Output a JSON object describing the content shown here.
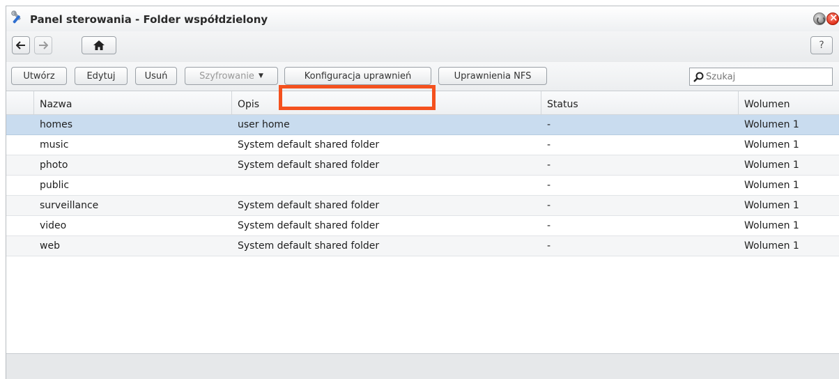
{
  "window": {
    "title": "Panel sterowania - Folder współdzielony",
    "icon": "control-panel-tools-icon"
  },
  "nav": {
    "back_icon": "arrow-left-icon",
    "forward_icon": "arrow-right-icon",
    "home_icon": "home-icon",
    "help_label": "?"
  },
  "toolbar": {
    "create_label": "Utwórz",
    "edit_label": "Edytuj",
    "delete_label": "Usuń",
    "encryption_label": "Szyfrowanie",
    "permissions_label": "Konfiguracja uprawnień",
    "nfs_label": "Uprawnienia NFS",
    "search_placeholder": "Szukaj"
  },
  "table": {
    "columns": [
      "",
      "Nazwa",
      "Opis",
      "Status",
      "Wolumen"
    ],
    "rows": [
      {
        "name": "homes",
        "description": "user home",
        "status": "-",
        "volume": "Wolumen 1",
        "selected": true
      },
      {
        "name": "music",
        "description": "System default shared folder",
        "status": "-",
        "volume": "Wolumen 1"
      },
      {
        "name": "photo",
        "description": "System default shared folder",
        "status": "-",
        "volume": "Wolumen 1"
      },
      {
        "name": "public",
        "description": "",
        "status": "-",
        "volume": "Wolumen 1"
      },
      {
        "name": "surveillance",
        "description": "System default shared folder",
        "status": "-",
        "volume": "Wolumen 1"
      },
      {
        "name": "video",
        "description": "System default shared folder",
        "status": "-",
        "volume": "Wolumen 1"
      },
      {
        "name": "web",
        "description": "System default shared folder",
        "status": "-",
        "volume": "Wolumen 1"
      }
    ]
  },
  "colors": {
    "selected_row": "#c9dcef",
    "highlight_box": "#f4511e",
    "close_button": "#e0311b"
  }
}
